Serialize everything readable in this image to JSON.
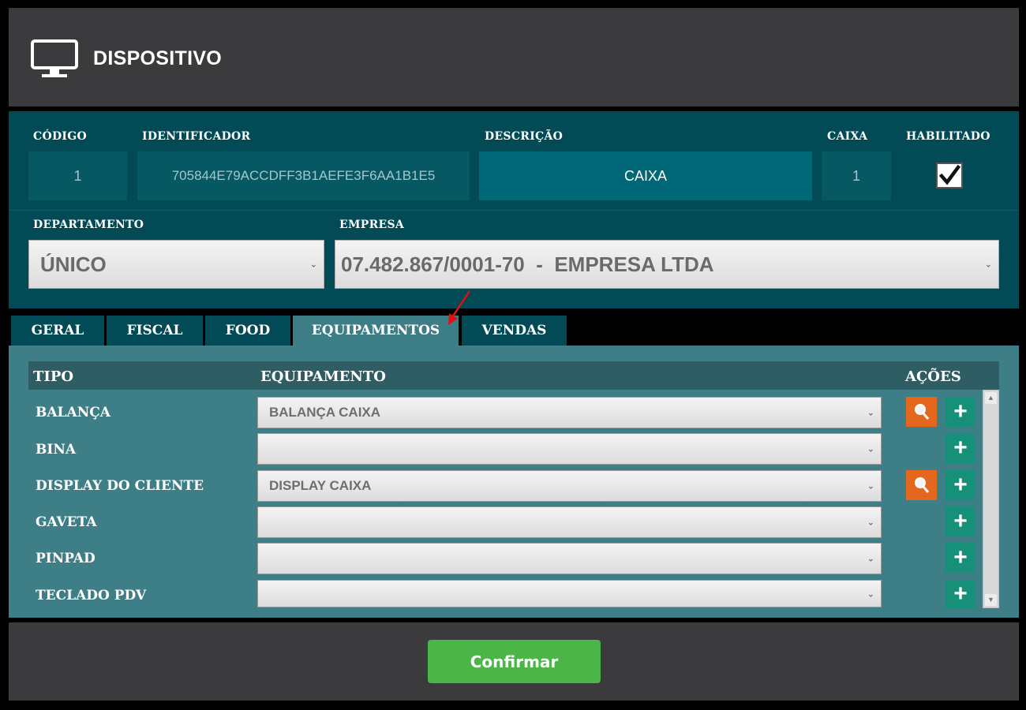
{
  "header": {
    "title": "DISPOSITIVO",
    "icon": "monitor-icon"
  },
  "form": {
    "codigo": {
      "label": "CÓDIGO",
      "value": "1"
    },
    "identificador": {
      "label": "IDENTIFICADOR",
      "value": "705844E79ACCDFF3B1AEFE3F6AA1B1E5"
    },
    "descricao": {
      "label": "DESCRIÇÃO",
      "value": "CAIXA"
    },
    "caixa": {
      "label": "CAIXA",
      "value": "1"
    },
    "habilitado": {
      "label": "HABILITADO",
      "checked": true
    },
    "departamento": {
      "label": "DEPARTAMENTO",
      "value": "ÚNICO"
    },
    "empresa": {
      "label": "EMPRESA",
      "value": "07.482.867/0001-70  -  EMPRESA LTDA"
    }
  },
  "tabs": [
    {
      "label": "GERAL",
      "active": false
    },
    {
      "label": "FISCAL",
      "active": false
    },
    {
      "label": "FOOD",
      "active": false
    },
    {
      "label": "EQUIPAMENTOS",
      "active": true
    },
    {
      "label": "VENDAS",
      "active": false
    }
  ],
  "equipamentos": {
    "headers": {
      "tipo": "TIPO",
      "equipamento": "EQUIPAMENTO",
      "acoes": "AÇÕES"
    },
    "rows": [
      {
        "tipo": "BALANÇA",
        "equipamento": "BALANÇA CAIXA",
        "has_search": true
      },
      {
        "tipo": "BINA",
        "equipamento": "",
        "has_search": false
      },
      {
        "tipo": "DISPLAY DO CLIENTE",
        "equipamento": "DISPLAY CAIXA",
        "has_search": true
      },
      {
        "tipo": "GAVETA",
        "equipamento": "",
        "has_search": false
      },
      {
        "tipo": "PINPAD",
        "equipamento": "",
        "has_search": false
      },
      {
        "tipo": "TECLADO PDV",
        "equipamento": "",
        "has_search": false
      }
    ],
    "add_symbol": "+"
  },
  "footer": {
    "confirm_label": "Confirmar"
  },
  "colors": {
    "header_bg": "#3b3b3d",
    "panel_bg": "#024a55",
    "active_tab": "#3c7d86",
    "search_btn": "#e4671e",
    "add_btn": "#17907a",
    "confirm_btn": "#4bb548",
    "annotation_arrow": "#e01010"
  }
}
